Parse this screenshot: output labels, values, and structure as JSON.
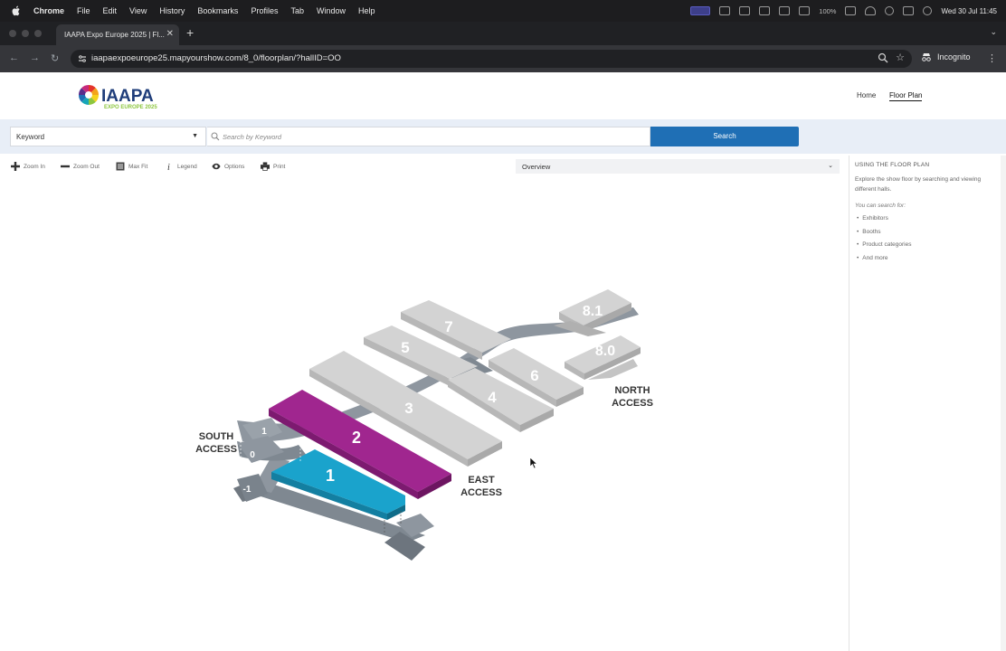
{
  "menubar": {
    "app": "Chrome",
    "items": [
      "File",
      "Edit",
      "View",
      "History",
      "Bookmarks",
      "Profiles",
      "Tab",
      "Window",
      "Help"
    ],
    "battery": "100%",
    "datetime": "Wed 30 Jul  11:45"
  },
  "browser": {
    "tab_title": "IAAPA Expo Europe 2025 | Fl...",
    "url": "iaapaexpoeurope25.mapyourshow.com/8_0/floorplan/?hallID=OO",
    "profile": "Incognito"
  },
  "site": {
    "logo_text": "IAAPA",
    "logo_subtext": "EXPO EUROPE 2025",
    "nav": [
      "Home",
      "Floor Plan"
    ]
  },
  "search": {
    "filter_value": "Keyword",
    "placeholder": "Search by Keyword",
    "button_label": "Search"
  },
  "tools": {
    "zoom_in": "Zoom In",
    "zoom_out": "Zoom Out",
    "max_fit": "Max Fit",
    "legend": "Legend",
    "options": "Options",
    "print": "Print",
    "hall_select": "Overview"
  },
  "sidepanel": {
    "title": "USING THE FLOOR PLAN",
    "description": "Explore the show floor by searching and viewing different halls.",
    "subtitle": "You can search for:",
    "items": [
      "Exhibitors",
      "Booths",
      "Product categories",
      "And more"
    ]
  },
  "map": {
    "halls": [
      "1",
      "2",
      "3",
      "4",
      "5",
      "6",
      "7",
      "8.0",
      "8.1"
    ],
    "levels": [
      "1",
      "0",
      "-1"
    ],
    "access_labels": {
      "south": [
        "SOUTH",
        "ACCESS"
      ],
      "east": [
        "EAST",
        "ACCESS"
      ],
      "north": [
        "NORTH",
        "ACCESS"
      ]
    },
    "colors": {
      "hall_gray": "#d3d3d3",
      "hall_1": "#1aa3cc",
      "hall_2": "#a0268f",
      "walkway": "#8e969f",
      "accent_blue": "#1f6fb5"
    }
  }
}
